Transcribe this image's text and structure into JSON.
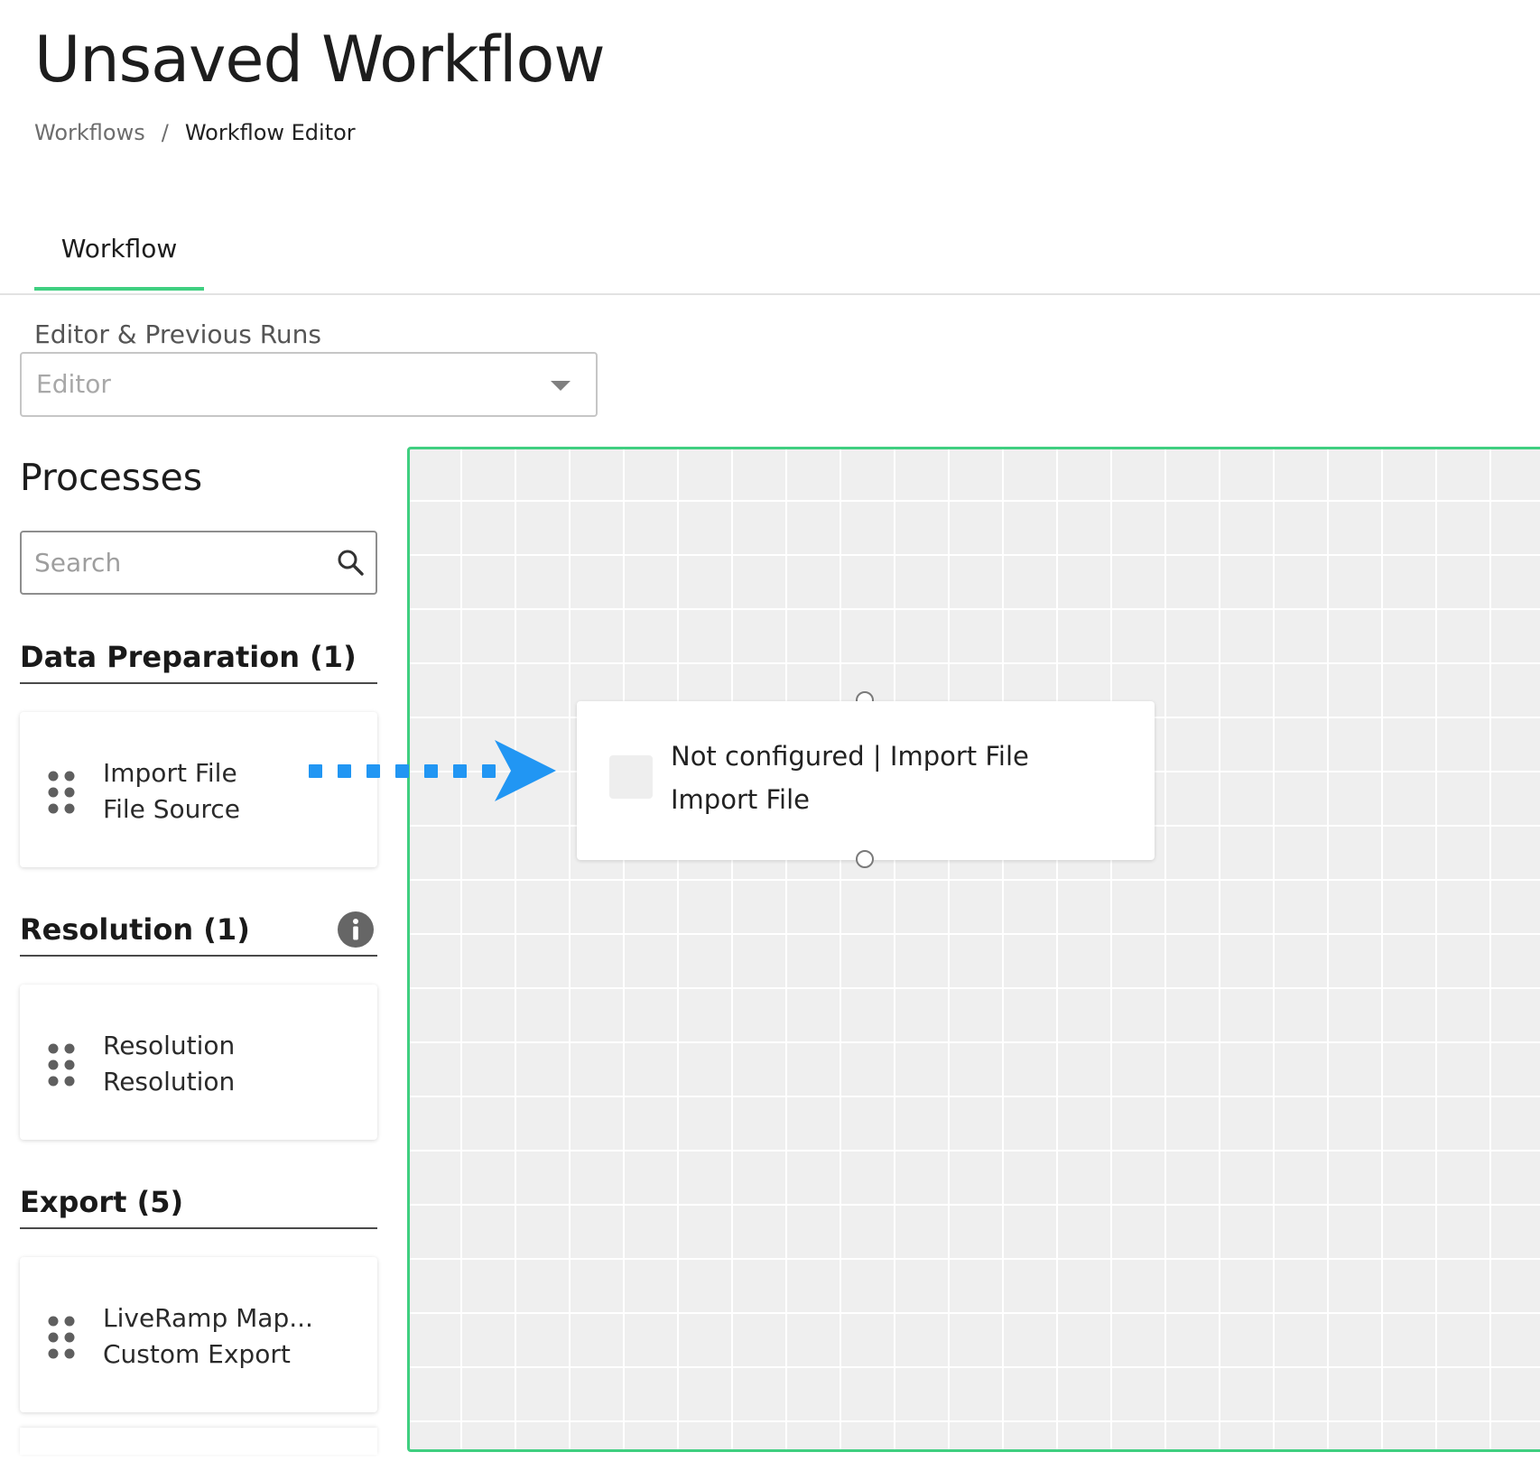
{
  "page": {
    "title": "Unsaved Workflow"
  },
  "breadcrumb": {
    "items": [
      "Workflows",
      "Workflow Editor"
    ],
    "separator": "/"
  },
  "tabs": [
    {
      "label": "Workflow",
      "active": true
    }
  ],
  "run_selector": {
    "label": "Editor & Previous Runs",
    "value": "Editor"
  },
  "processes": {
    "title": "Processes",
    "search_placeholder": "Search",
    "sections": [
      {
        "title": "Data Preparation (1)",
        "items": [
          {
            "name": "Import File",
            "type": "File Source"
          }
        ]
      },
      {
        "title": "Resolution (1)",
        "has_info": true,
        "items": [
          {
            "name": "Resolution",
            "type": "Resolution"
          }
        ]
      },
      {
        "title": "Export (5)",
        "items": [
          {
            "name": "LiveRamp Map...",
            "type": "Custom Export"
          }
        ]
      }
    ]
  },
  "canvas": {
    "node": {
      "title": "Not configured | Import File",
      "subtitle": "Import File"
    }
  },
  "colors": {
    "accent": "#3fcf80",
    "drag_arrow": "#2196f3",
    "canvas_background": "#efefef",
    "grid_line": "#ffffff"
  },
  "icons": {
    "search": "search-icon",
    "info": "info-icon",
    "drag_handle": "drag-handle-icon",
    "dropdown": "caret-down-icon",
    "drag_arrow": "arrow-right-icon"
  }
}
